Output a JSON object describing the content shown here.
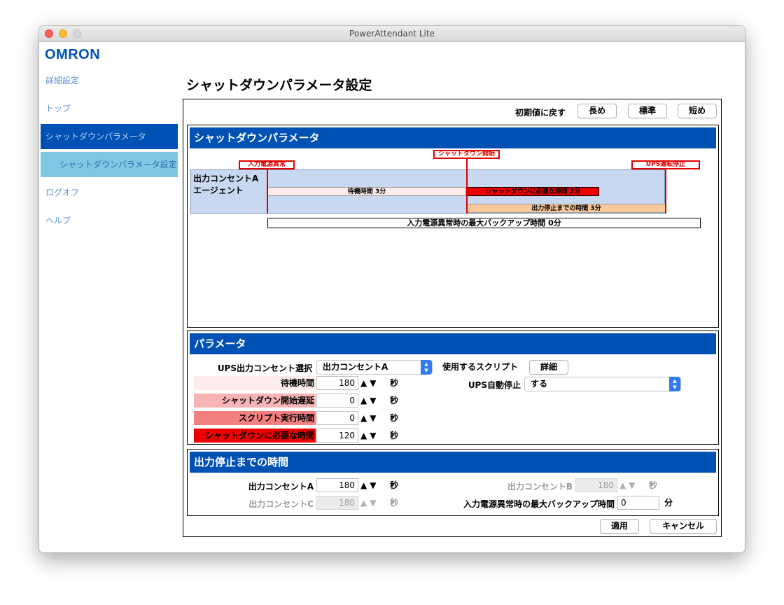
{
  "window": {
    "title": "PowerAttendant Lite"
  },
  "brand": {
    "logo_text": "OMRON",
    "color": "#0051b4"
  },
  "sidebar": {
    "items": [
      {
        "label": "詳細設定"
      },
      {
        "label": "トップ"
      },
      {
        "label": "シャットダウンパラメータ"
      },
      {
        "label": "シャットダウンパラメータ設定"
      },
      {
        "label": "ログオフ"
      },
      {
        "label": "ヘルプ"
      }
    ]
  },
  "page": {
    "title": "シャットダウンパラメータ設定"
  },
  "presets": {
    "label": "初期値に戻す",
    "long": "長め",
    "standard": "標準",
    "short": "短め"
  },
  "timeline_panel": {
    "title": "シャットダウンパラメータ",
    "markers": {
      "power_fail": "入力電源異常",
      "shutdown_start": "シャットダウン開始",
      "ups_stop": "UPS運転停止"
    },
    "row_label_line1": "出力コンセントA",
    "row_label_line2": "エージェント",
    "wait_bar": "待機時間 3分",
    "shutdown_bar": "シャットダウンに必要な時間 2分",
    "output_stop_bar": "出力停止までの時間 3分",
    "backup_bar": "入力電源異常時の最大バックアップ時間 0分"
  },
  "params_panel": {
    "title": "パラメータ",
    "outlet_select_label": "UPS出力コンセント選択",
    "outlet_select_value": "出力コンセントA",
    "script_label": "使用するスクリプト",
    "script_button": "詳細",
    "auto_stop_label": "UPS自動停止",
    "auto_stop_value": "する",
    "rows": [
      {
        "label": "待機時間",
        "value": "180",
        "unit": "秒",
        "color": "#fdeceb"
      },
      {
        "label": "シャットダウン開始遅延",
        "value": "0",
        "unit": "秒",
        "color": "#f8b4b4"
      },
      {
        "label": "スクリプト実行時間",
        "value": "0",
        "unit": "秒",
        "color": "#f28080"
      },
      {
        "label": "シャットダウンに必要な時間",
        "value": "120",
        "unit": "秒",
        "color": "#ee0000"
      }
    ]
  },
  "output_panel": {
    "title": "出力停止までの時間",
    "outlet_a": {
      "label": "出力コンセントA",
      "value": "180",
      "unit": "秒"
    },
    "outlet_b": {
      "label": "出力コンセントB",
      "value": "180",
      "unit": "秒"
    },
    "outlet_c": {
      "label": "出力コンセントC",
      "value": "180",
      "unit": "秒"
    },
    "backup": {
      "label": "入力電源異常時の最大バックアップ時間",
      "value": "0",
      "unit": "分"
    }
  },
  "footer": {
    "apply": "適用",
    "cancel": "キャンセル"
  },
  "icons": {
    "spin_up": "▲",
    "spin_down": "▼"
  }
}
